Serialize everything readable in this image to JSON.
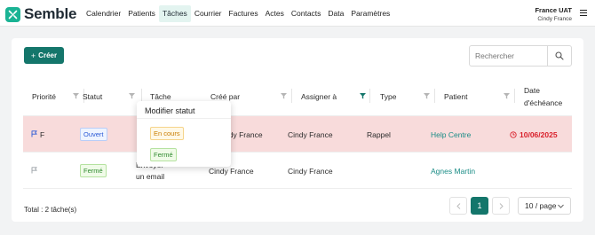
{
  "brand": {
    "name": "Semble",
    "color": "#1ab394"
  },
  "nav": {
    "items": [
      "Calendrier",
      "Patients",
      "Tâches",
      "Courrier",
      "Factures",
      "Actes",
      "Contacts",
      "Data",
      "Paramètres"
    ],
    "active": "Tâches"
  },
  "user": {
    "name": "France UAT",
    "subtitle": "Cindy France"
  },
  "toolbar": {
    "create_label": "Créer",
    "search_placeholder": "Rechercher"
  },
  "table": {
    "columns": {
      "priority": "Priorité",
      "status": "Statut",
      "task": "Tâche",
      "created_by": "Créé par",
      "assigned_to": "Assigner à",
      "type": "Type",
      "patient": "Patient",
      "due_date_line1": "Date",
      "due_date_line2": "d'échéance"
    },
    "rows": [
      {
        "priority": "F",
        "status": "Ouvert",
        "task": "",
        "created_by": "Cindy France",
        "assigned_to": "Cindy France",
        "type": "Rappel",
        "patient": "Help Centre",
        "due_date": "10/06/2025"
      },
      {
        "priority": "",
        "status": "Fermé",
        "task_line1": "Envoyer",
        "task_line2": "un email",
        "created_by": "Cindy France",
        "assigned_to": "Cindy France",
        "type": "",
        "patient": "Agnes Martin",
        "due_date": ""
      }
    ]
  },
  "footer": {
    "total": "Total : 2 tâche(s)",
    "current_page": "1",
    "page_size": "10 / page"
  },
  "popover": {
    "title": "Modifier statut",
    "options": [
      "En cours",
      "Fermé"
    ]
  },
  "colors": {
    "accent": "#14766b",
    "overdue_row": "#f8dbdb",
    "overdue_text": "#d9202b",
    "link": "#1a8c86"
  }
}
